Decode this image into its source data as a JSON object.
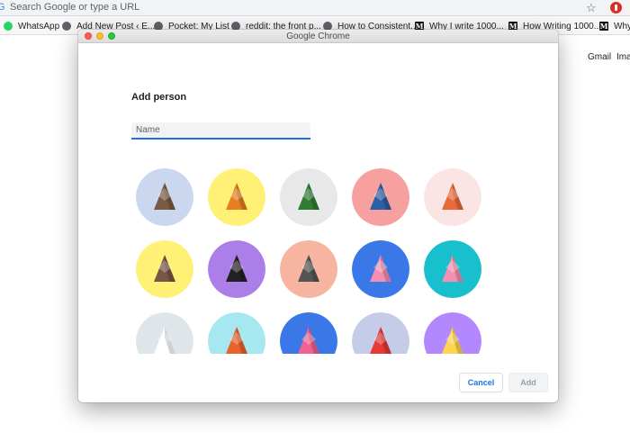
{
  "browser": {
    "omnibox_placeholder": "Search Google or type a URL",
    "bookmarks": [
      {
        "label": "WhatsApp",
        "icon": "whatsapp-icon"
      },
      {
        "label": "Add New Post ‹ E...",
        "icon": "globe-icon"
      },
      {
        "label": "Pocket: My List",
        "icon": "globe-icon"
      },
      {
        "label": "reddit: the front p...",
        "icon": "globe-icon"
      },
      {
        "label": "How to Consistent...",
        "icon": "globe-icon"
      },
      {
        "label": "Why I write 1000...",
        "icon": "medium-icon"
      },
      {
        "label": "How Writing 1000...",
        "icon": "medium-icon"
      },
      {
        "label": "Why",
        "icon": "medium-icon"
      }
    ],
    "page_links": {
      "gmail": "Gmail",
      "images": "Ima"
    }
  },
  "dialog": {
    "window_title": "Google Chrome",
    "heading": "Add person",
    "name_placeholder": "Name",
    "name_value": "",
    "avatars": [
      {
        "name": "cat",
        "bg": "#cbd7ee",
        "fg": "#7a5a43"
      },
      {
        "name": "corgi",
        "bg": "#fff176",
        "fg": "#e67e22"
      },
      {
        "name": "dragon",
        "bg": "#e8e8e8",
        "fg": "#2e7d32"
      },
      {
        "name": "elephant",
        "bg": "#f6a0a0",
        "fg": "#2b5fa8"
      },
      {
        "name": "fox",
        "bg": "#fbe4e4",
        "fg": "#e8693a"
      },
      {
        "name": "monkey",
        "bg": "#fff176",
        "fg": "#795548"
      },
      {
        "name": "panda",
        "bg": "#ab7ee8",
        "fg": "#222222"
      },
      {
        "name": "penguin",
        "bg": "#f7b4a0",
        "fg": "#555555"
      },
      {
        "name": "butterfly",
        "bg": "#3b78e7",
        "fg": "#f48fb1"
      },
      {
        "name": "rabbit",
        "bg": "#17c0cc",
        "fg": "#f48fb1"
      },
      {
        "name": "unicorn",
        "bg": "#dfe6ea",
        "fg": "#ffffff"
      },
      {
        "name": "basketball",
        "bg": "#a7e8f0",
        "fg": "#e8622a"
      },
      {
        "name": "bicycle",
        "bg": "#3b78e7",
        "fg": "#f06292"
      },
      {
        "name": "bird",
        "bg": "#c5cce8",
        "fg": "#e53935"
      },
      {
        "name": "cheese",
        "bg": "#b388ff",
        "fg": "#ffd54f"
      }
    ],
    "cancel_label": "Cancel",
    "add_label": "Add"
  },
  "colors": {
    "accent": "#1a73e8",
    "disabled_text": "#9aa0a6"
  }
}
